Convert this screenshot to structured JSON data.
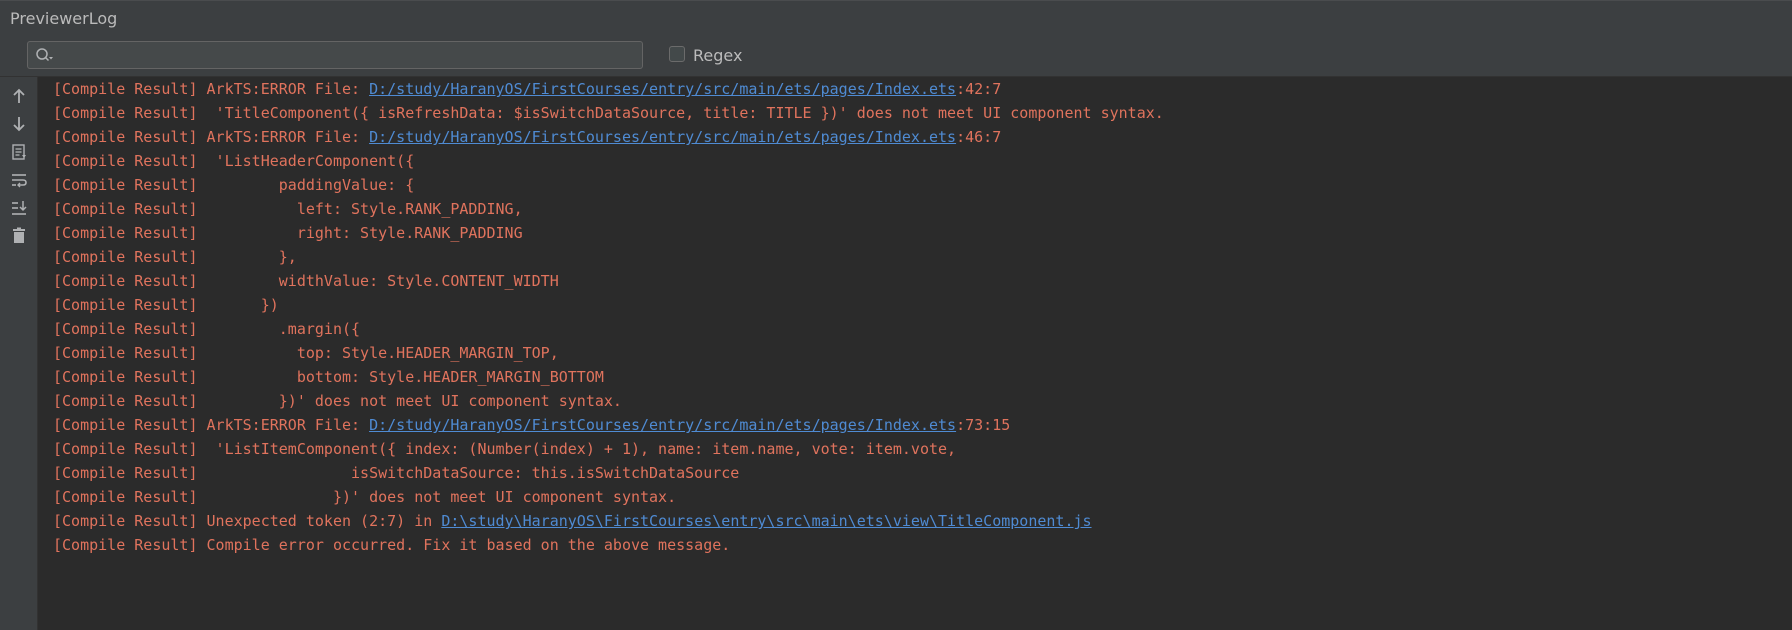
{
  "window": {
    "title": "PreviewerLog"
  },
  "toolbar": {
    "search": {
      "value": "",
      "placeholder": ""
    },
    "regex": {
      "label": "Regex",
      "checked": false
    }
  },
  "sidebar": {
    "icons": [
      "arrow-up-icon",
      "arrow-down-icon",
      "filter-log-icon",
      "soft-wrap-icon",
      "scroll-to-end-icon",
      "trash-icon"
    ]
  },
  "colors": {
    "log_text": "#e0735d",
    "link": "#4f8bd3",
    "background": "#2b2b2b",
    "panel": "#3c3f41"
  },
  "log": {
    "lines": [
      {
        "prefix": "[Compile Result] ArkTS:ERROR File: ",
        "link": "D:/study/HaranyOS/FirstCourses/entry/src/main/ets/pages/Index.ets",
        "suffix": ":42:7"
      },
      {
        "prefix": "[Compile Result]  'TitleComponent({ isRefreshData: $isSwitchDataSource, title: TITLE })' does not meet UI component syntax.",
        "link": "",
        "suffix": ""
      },
      {
        "prefix": "[Compile Result] ArkTS:ERROR File: ",
        "link": "D:/study/HaranyOS/FirstCourses/entry/src/main/ets/pages/Index.ets",
        "suffix": ":46:7"
      },
      {
        "prefix": "[Compile Result]  'ListHeaderComponent({",
        "link": "",
        "suffix": ""
      },
      {
        "prefix": "[Compile Result]         paddingValue: {",
        "link": "",
        "suffix": ""
      },
      {
        "prefix": "[Compile Result]           left: Style.RANK_PADDING,",
        "link": "",
        "suffix": ""
      },
      {
        "prefix": "[Compile Result]           right: Style.RANK_PADDING",
        "link": "",
        "suffix": ""
      },
      {
        "prefix": "[Compile Result]         },",
        "link": "",
        "suffix": ""
      },
      {
        "prefix": "[Compile Result]         widthValue: Style.CONTENT_WIDTH",
        "link": "",
        "suffix": ""
      },
      {
        "prefix": "[Compile Result]       })",
        "link": "",
        "suffix": ""
      },
      {
        "prefix": "[Compile Result]         .margin({",
        "link": "",
        "suffix": ""
      },
      {
        "prefix": "[Compile Result]           top: Style.HEADER_MARGIN_TOP,",
        "link": "",
        "suffix": ""
      },
      {
        "prefix": "[Compile Result]           bottom: Style.HEADER_MARGIN_BOTTOM",
        "link": "",
        "suffix": ""
      },
      {
        "prefix": "[Compile Result]         })' does not meet UI component syntax.",
        "link": "",
        "suffix": ""
      },
      {
        "prefix": "[Compile Result] ArkTS:ERROR File: ",
        "link": "D:/study/HaranyOS/FirstCourses/entry/src/main/ets/pages/Index.ets",
        "suffix": ":73:15"
      },
      {
        "prefix": "[Compile Result]  'ListItemComponent({ index: (Number(index) + 1), name: item.name, vote: item.vote,",
        "link": "",
        "suffix": ""
      },
      {
        "prefix": "[Compile Result]                 isSwitchDataSource: this.isSwitchDataSource",
        "link": "",
        "suffix": ""
      },
      {
        "prefix": "[Compile Result]               })' does not meet UI component syntax.",
        "link": "",
        "suffix": ""
      },
      {
        "prefix": "[Compile Result] Unexpected token (2:7) in ",
        "link": "D:\\study\\HaranyOS\\FirstCourses\\entry\\src\\main\\ets\\view\\TitleComponent.js",
        "suffix": ""
      },
      {
        "prefix": "[Compile Result] Compile error occurred. Fix it based on the above message.",
        "link": "",
        "suffix": ""
      }
    ]
  }
}
